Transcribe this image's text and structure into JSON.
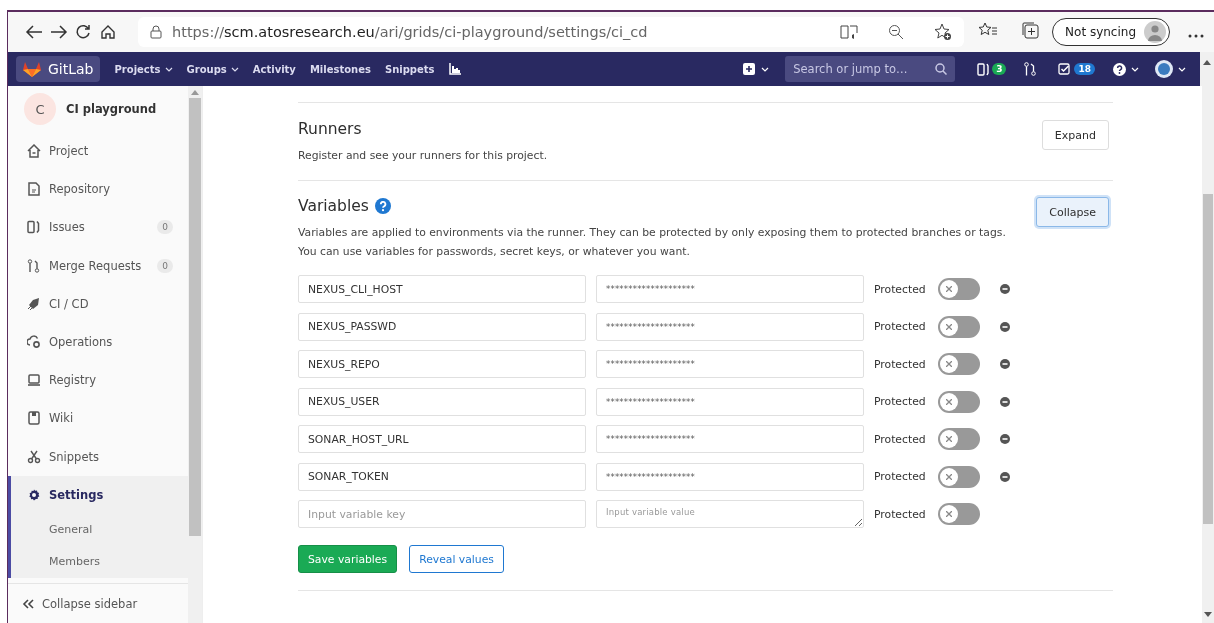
{
  "browser": {
    "url": {
      "scheme": "https://",
      "host": "scm.atosresearch.eu",
      "path": "/ari/grids/ci-playground/settings/ci_cd"
    },
    "sync_button": "Not syncing"
  },
  "navbar": {
    "brand": "GitLab",
    "menu": [
      {
        "label": "Projects",
        "dropdown": true
      },
      {
        "label": "Groups",
        "dropdown": true
      },
      {
        "label": "Activity",
        "dropdown": false
      },
      {
        "label": "Milestones",
        "dropdown": false
      },
      {
        "label": "Snippets",
        "dropdown": false
      }
    ],
    "search": {
      "placeholder": "Search or jump to…"
    },
    "issues_count": "3",
    "todos_count": "18"
  },
  "sidebar": {
    "project": {
      "avatar_letter": "C",
      "name": "CI playground"
    },
    "items": [
      {
        "label": "Project",
        "selected": false
      },
      {
        "label": "Repository",
        "selected": false
      },
      {
        "label": "Issues",
        "count": "0",
        "selected": false
      },
      {
        "label": "Merge Requests",
        "count": "0",
        "selected": false
      },
      {
        "label": "CI / CD",
        "selected": false
      },
      {
        "label": "Operations",
        "selected": false
      },
      {
        "label": "Registry",
        "selected": false
      },
      {
        "label": "Wiki",
        "selected": false
      },
      {
        "label": "Snippets",
        "selected": false
      },
      {
        "label": "Settings",
        "selected": true,
        "children": [
          {
            "label": "General"
          },
          {
            "label": "Members"
          }
        ]
      }
    ],
    "collapse": "Collapse sidebar"
  },
  "sections": [
    {
      "title": "Runners",
      "description": "Register and see your runners for this project.",
      "button": "Expand",
      "help": false
    },
    {
      "title": "Variables",
      "description": "Variables are applied to environments via the runner. They can be protected by only exposing them to protected branches or tags. You can use variables for passwords, secret keys, or whatever you want.",
      "button": "Collapse",
      "help": true
    }
  ],
  "variables": [
    {
      "kind": "entry",
      "key": "NEXUS_CLI_HOST",
      "value": "********************",
      "protected_label": "Protected",
      "protected": false
    },
    {
      "kind": "entry",
      "key": "NEXUS_PASSWD",
      "value": "********************",
      "protected_label": "Protected",
      "protected": false
    },
    {
      "kind": "entry",
      "key": "NEXUS_REPO",
      "value": "********************",
      "protected_label": "Protected",
      "protected": false
    },
    {
      "kind": "entry",
      "key": "NEXUS_USER",
      "value": "********************",
      "protected_label": "Protected",
      "protected": false
    },
    {
      "kind": "entry",
      "key": "SONAR_HOST_URL",
      "value": "********************",
      "protected_label": "Protected",
      "protected": false
    },
    {
      "kind": "entry",
      "key": "SONAR_TOKEN",
      "value": "********************",
      "protected_label": "Protected",
      "protected": false
    },
    {
      "kind": "new",
      "key_placeholder": "Input variable key",
      "value_placeholder": "Input variable value",
      "protected_label": "Protected",
      "protected": false
    }
  ],
  "actions": {
    "save": "Save variables",
    "reveal": "Reveal values"
  }
}
